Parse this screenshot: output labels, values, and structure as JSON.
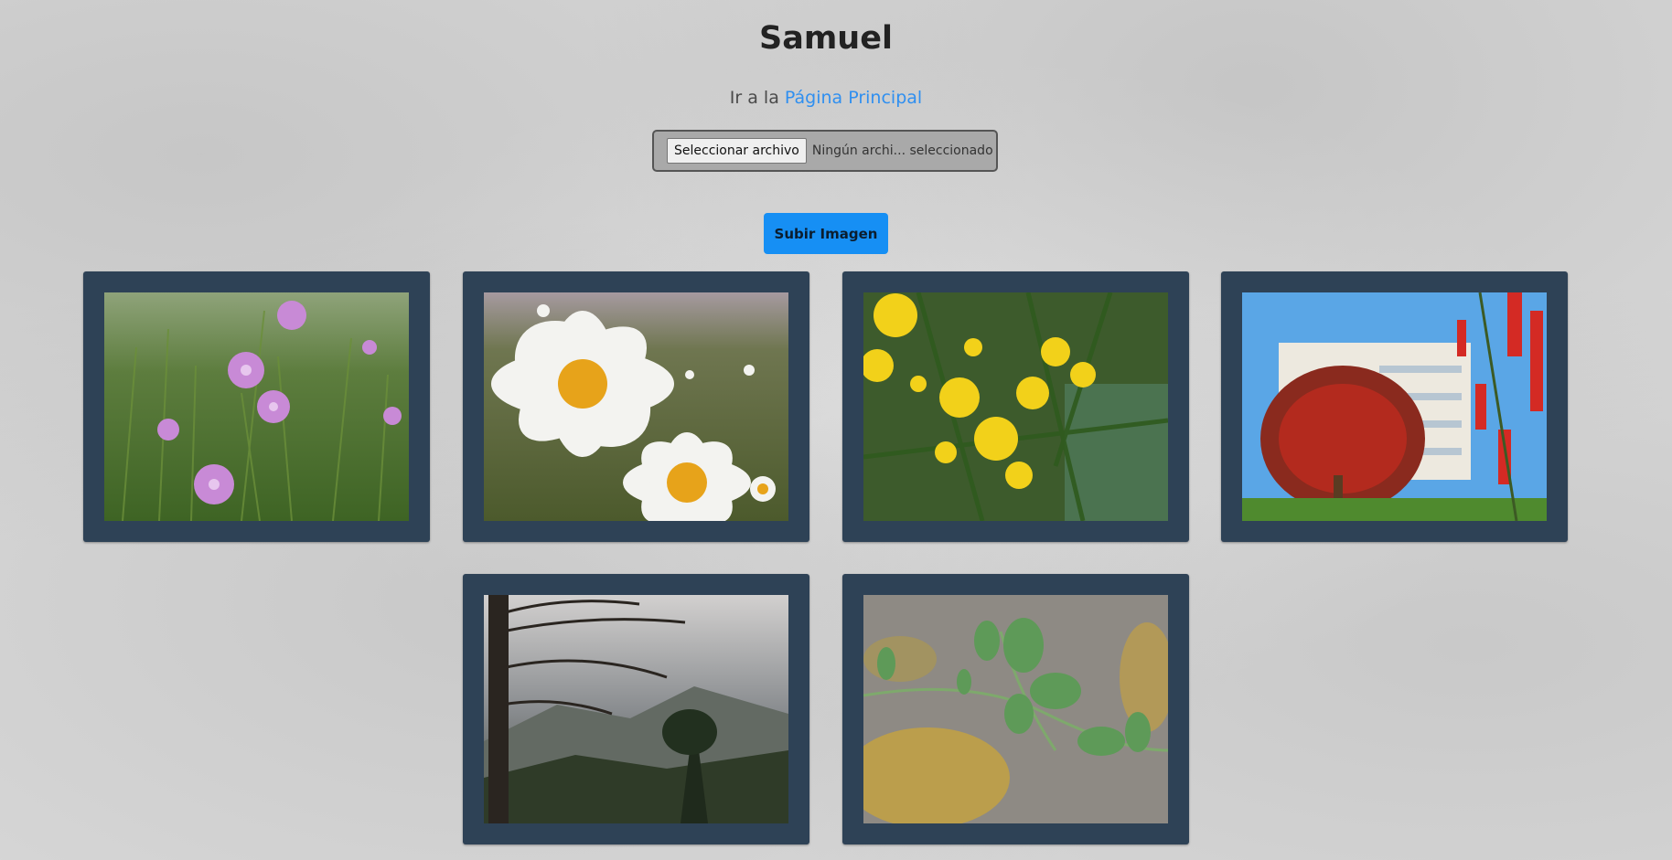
{
  "header": {
    "title": "Samuel",
    "nav_prefix": "Ir a la",
    "nav_link": "Página Principal"
  },
  "upload": {
    "file_button": "Seleccionar archivo",
    "file_status": "Ningún archi... seleccionado",
    "submit_label": "Subir Imagen"
  },
  "colors": {
    "accent": "#168ff4",
    "link": "#2f8ff0",
    "card_frame": "#2e4256",
    "background": "#d6d6d6"
  },
  "gallery": {
    "images": [
      {
        "subject": "pink-wildflowers-photo"
      },
      {
        "subject": "white-daisies-photo"
      },
      {
        "subject": "yellow-mimosa-photo"
      },
      {
        "subject": "red-bottlebrush-tree-photo"
      },
      {
        "subject": "pine-tree-mountains-photo"
      },
      {
        "subject": "green-vine-on-rock-photo"
      }
    ]
  }
}
